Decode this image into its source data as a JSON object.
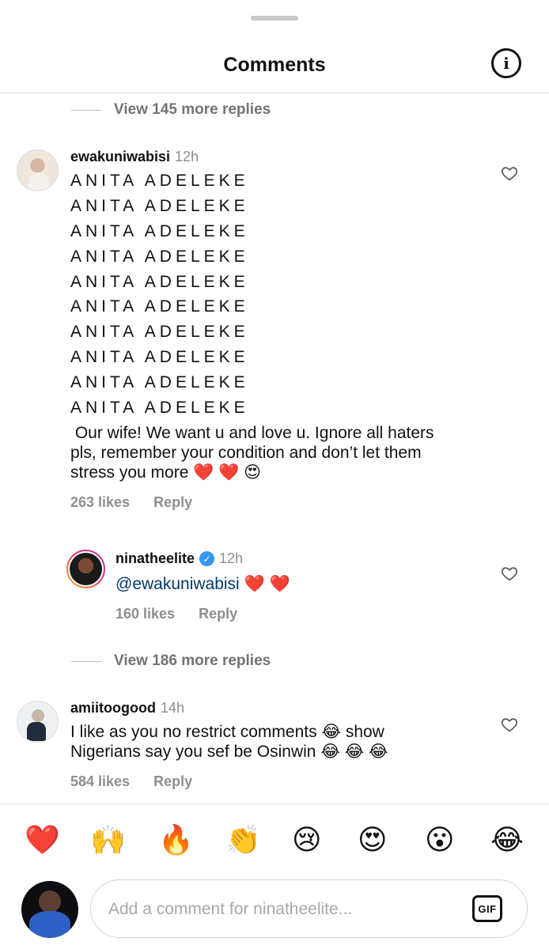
{
  "header": {
    "title": "Comments",
    "info_icon": "info-icon"
  },
  "thread1": {
    "view_replies": "View 145 more replies",
    "comment": {
      "username": "ewakuniwabisi",
      "time": "12h",
      "lines": [
        "ANITA ADELEKE",
        "ANITA ADELEKE",
        "ANITA ADELEKE",
        "ANITA ADELEKE",
        "ANITA ADELEKE",
        "ANITA ADELEKE",
        "ANITA ADELEKE",
        "ANITA ADELEKE",
        "ANITA ADELEKE",
        "ANITA ADELEKE"
      ],
      "body_1": " Our wife! We want u and love u. Ignore all haters",
      "body_2": "pls, remember your condition and don’t let them",
      "body_3": "stress you more ❤️ ❤️ 😍",
      "likes": "263 likes",
      "reply": "Reply"
    },
    "reply": {
      "username": "ninatheelite",
      "verified": true,
      "time": "12h",
      "mention": "@ewakuniwabisi",
      "text": " ❤️ ❤️",
      "likes": "160 likes",
      "reply": "Reply"
    }
  },
  "thread2": {
    "view_replies": "View 186 more replies",
    "comment": {
      "username": "amiitoogood",
      "time": "14h",
      "body_1": "I like as you no restrict comments 😂 show",
      "body_2": "Nigerians say you sef be Osinwin 😂 😂 😂",
      "likes": "584 likes",
      "reply": "Reply"
    }
  },
  "emoji_bar": [
    "❤️",
    "🙌",
    "🔥",
    "👏",
    "😢",
    "😍",
    "😮",
    "😂"
  ],
  "composer": {
    "placeholder": "Add a comment for ninatheelite...",
    "gif_label": "GIF"
  }
}
